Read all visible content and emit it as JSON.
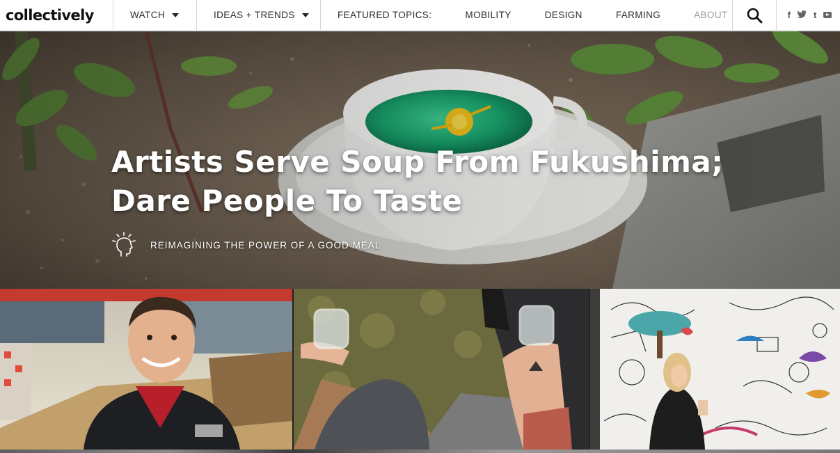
{
  "brand": {
    "logo_text": "collectively"
  },
  "nav": {
    "watch_label": "WATCH",
    "ideas_label": "IDEAS + TRENDS",
    "featured_label": "FEATURED TOPICS:",
    "topics": [
      "MOBILITY",
      "DESIGN",
      "FARMING",
      "ABOUT"
    ]
  },
  "social": {
    "icons": [
      "facebook-icon",
      "twitter-icon",
      "tumblr-icon",
      "youtube-icon"
    ],
    "labels": [
      "f",
      "t",
      "t"
    ]
  },
  "hero": {
    "title_line1": "Artists Serve Soup From Fukushima;",
    "title_line2": "Dare People To Taste",
    "tag_label": "REIMAGINING THE POWER OF A GOOD MEAL",
    "tag_icon": "thinking-head-icon"
  },
  "thumbnails": [
    {
      "icon": "portrait-photo"
    },
    {
      "icon": "jars-photo"
    },
    {
      "icon": "mural-photo"
    }
  ],
  "colors": {
    "nav_text": "#2b2b2b",
    "about_text": "#9a9a9a",
    "divider": "#d6d6d6"
  }
}
